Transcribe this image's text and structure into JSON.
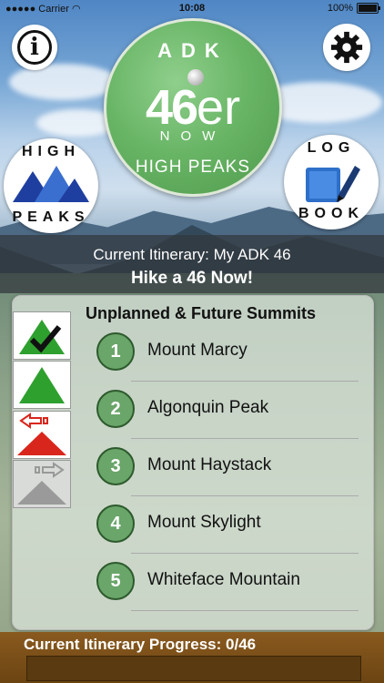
{
  "status_bar": {
    "carrier": "Carrier",
    "time": "10:08",
    "battery": "100%"
  },
  "top": {
    "info_label": "i",
    "logo": {
      "top_text": "ADK",
      "number": "46",
      "suffix": "er",
      "sub_text": "NOW",
      "bottom_text": "HIGH PEAKS"
    },
    "high_peaks_button": {
      "top": "HIGH",
      "bottom": "PEAKS"
    },
    "log_book_button": {
      "top": "LOG",
      "bottom": "BOOK"
    }
  },
  "itinerary": {
    "current": "Current Itinerary: My ADK 46",
    "cta": "Hike a 46 Now!"
  },
  "panel": {
    "title": "Unplanned & Future Summits",
    "filters": [
      "completed-filter",
      "planned-filter",
      "move-out-filter",
      "move-in-filter"
    ],
    "summits": [
      {
        "num": "1",
        "name": "Mount Marcy"
      },
      {
        "num": "2",
        "name": "Algonquin Peak"
      },
      {
        "num": "3",
        "name": "Mount Haystack"
      },
      {
        "num": "4",
        "name": "Mount Skylight"
      },
      {
        "num": "5",
        "name": "Whiteface Mountain"
      }
    ]
  },
  "progress": {
    "label": "Current Itinerary Progress: 0/46",
    "completed": 0,
    "total": 46
  },
  "colors": {
    "accent_green": "#6ab667",
    "red": "#d9261c",
    "wood": "#8a5a1f"
  }
}
